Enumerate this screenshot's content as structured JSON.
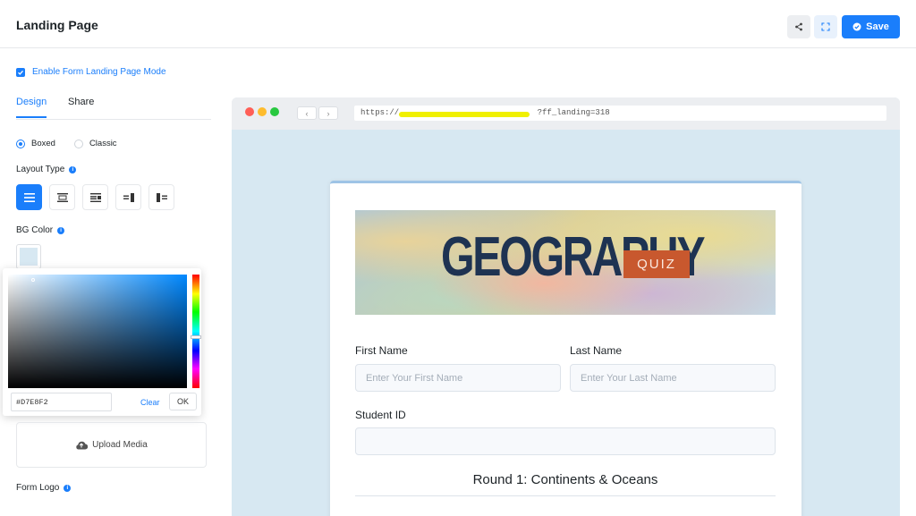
{
  "header": {
    "title": "Landing Page",
    "save_label": "Save"
  },
  "settings": {
    "enable_label": "Enable Form Landing Page Mode",
    "enable_checked": true,
    "tabs": [
      {
        "label": "Design",
        "active": true
      },
      {
        "label": "Share",
        "active": false
      }
    ],
    "style_options": [
      {
        "label": "Boxed",
        "selected": true
      },
      {
        "label": "Classic",
        "selected": false
      }
    ],
    "layout_type_label": "Layout Type",
    "bg_color_label": "BG Color",
    "bg_color_value": "#D7E8F2",
    "color_picker": {
      "hex_value": "#D7E8F2",
      "clear_label": "Clear",
      "ok_label": "OK"
    },
    "upload_label": "Upload Media",
    "form_logo_label": "Form Logo"
  },
  "preview": {
    "url_prefix": "https://",
    "url_suffix": "?ff_landing=318",
    "banner": {
      "title": "GEOGRAPHY",
      "tag": "QUIZ"
    },
    "form": {
      "first_name_label": "First Name",
      "first_name_placeholder": "Enter Your First Name",
      "last_name_label": "Last Name",
      "last_name_placeholder": "Enter Your Last Name",
      "student_id_label": "Student ID",
      "section_heading": "Round 1: Continents & Oceans"
    }
  },
  "colors": {
    "accent": "#1a7efb",
    "preview_bg": "#d7e8f2",
    "quiz_tag": "#c8582e"
  },
  "icons": [
    "share-icon",
    "fullscreen-icon",
    "check-circle-icon",
    "info-icon",
    "cloud-upload-icon",
    "chevron-left-icon",
    "chevron-right-icon"
  ]
}
